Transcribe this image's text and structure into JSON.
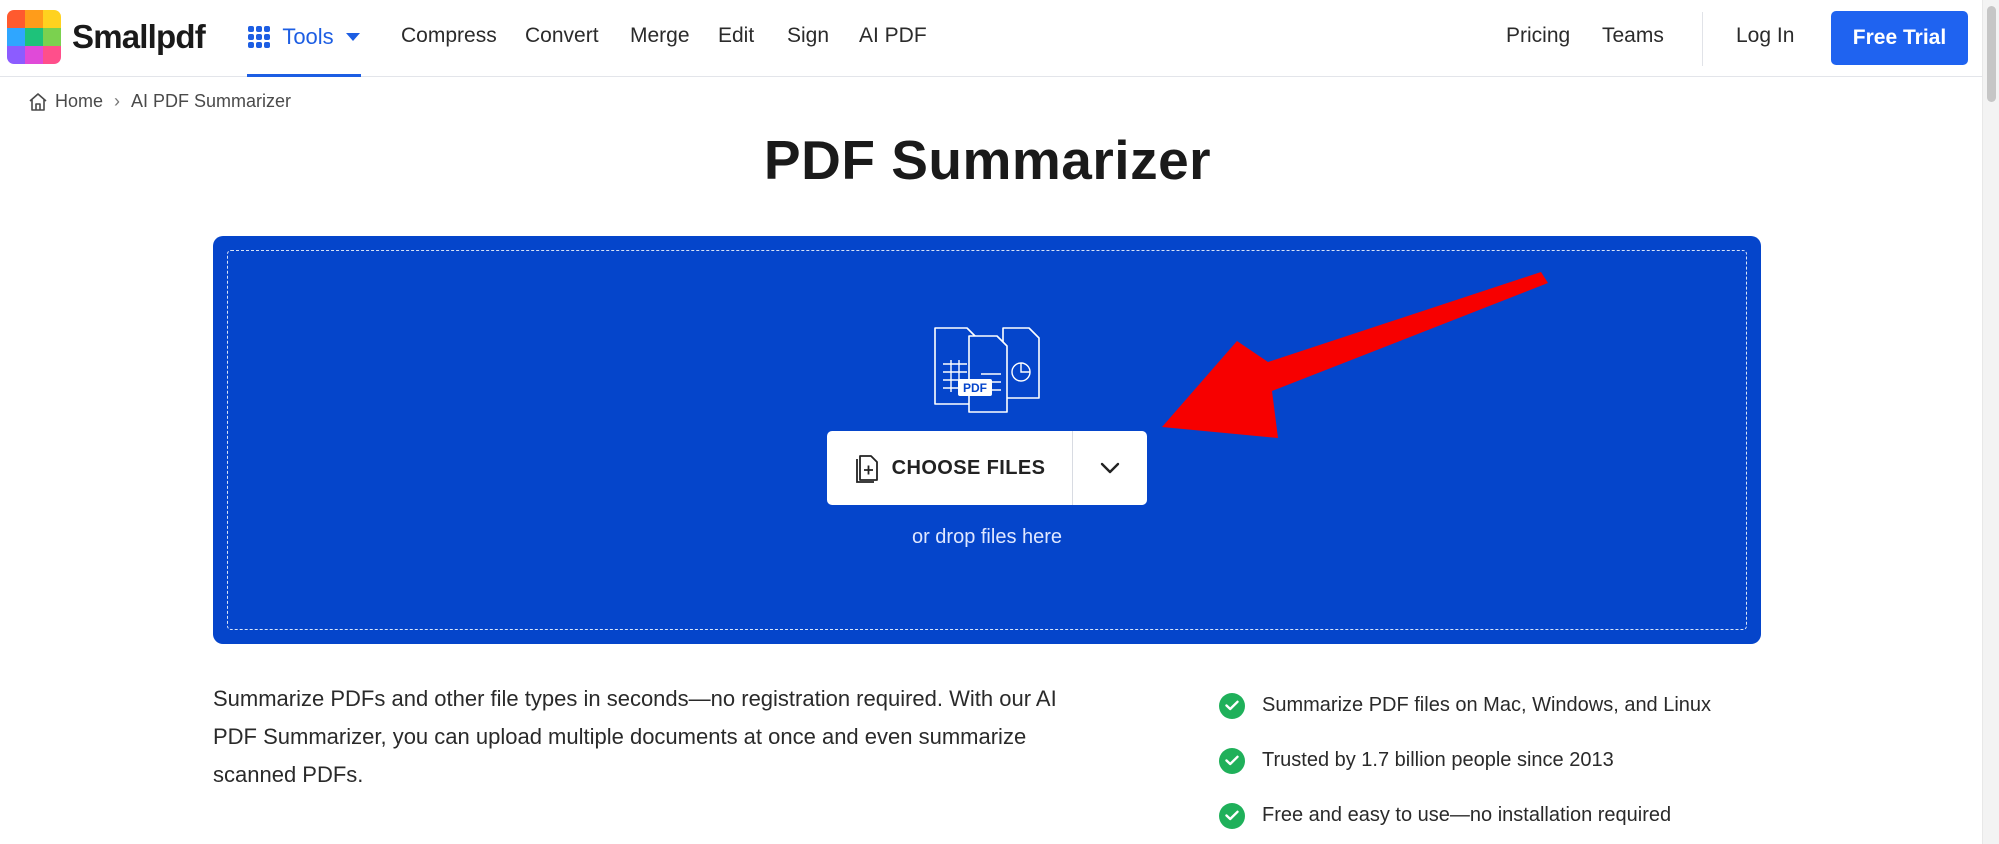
{
  "header": {
    "logo_text": "Smallpdf",
    "tools_label": "Tools",
    "nav": [
      {
        "label": "Compress"
      },
      {
        "label": "Convert"
      },
      {
        "label": "Merge"
      },
      {
        "label": "Edit"
      },
      {
        "label": "Sign"
      },
      {
        "label": "AI PDF"
      }
    ],
    "pricing": "Pricing",
    "teams": "Teams",
    "login": "Log In",
    "free_trial": "Free Trial"
  },
  "breadcrumb": {
    "home": "Home",
    "separator": "›",
    "current": "AI PDF Summarizer"
  },
  "main": {
    "title": "PDF Summarizer",
    "upload": {
      "illustration_label": "PDF",
      "choose_files": "CHOOSE FILES",
      "drop_hint": "or drop files here"
    },
    "description": "Summarize PDFs and other file types in seconds—no registration required. With our AI PDF Summarizer, you can upload multiple documents at once and even summarize scanned PDFs.",
    "features": [
      {
        "text": "Summarize PDF files on Mac, Windows, and Linux"
      },
      {
        "text": "Trusted by 1.7 billion people since 2013"
      },
      {
        "text": "Free and easy to use—no installation required"
      }
    ]
  },
  "colors": {
    "brand_blue": "#1f63f0",
    "dropzone_blue": "#0545cb",
    "check_green": "#1fb05a",
    "annotation_red": "#f70000"
  },
  "icons": [
    "smallpdf-logo-icon",
    "apps-grid-icon",
    "caret-down-icon",
    "home-icon",
    "files-illustration-icon",
    "add-file-icon",
    "chevron-down-icon",
    "check-circle-icon"
  ]
}
